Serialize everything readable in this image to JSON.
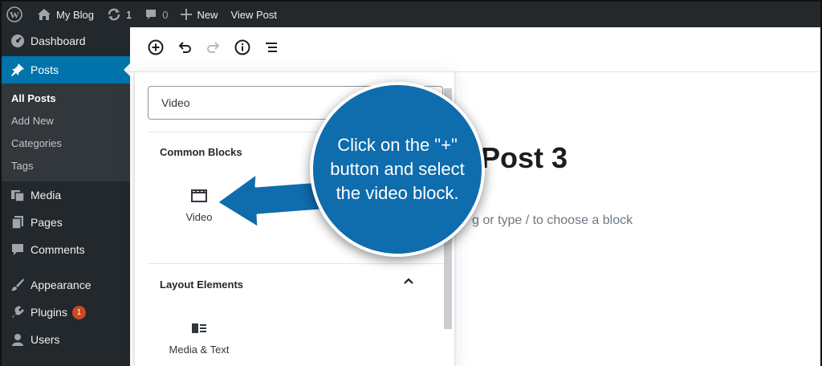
{
  "adminbar": {
    "site_name": "My Blog",
    "updates_count": "1",
    "comments_count": "0",
    "new_label": "New",
    "view_post_label": "View Post"
  },
  "sidebar": {
    "items": [
      {
        "label": "Dashboard",
        "icon": "dashboard-icon"
      },
      {
        "label": "Posts",
        "icon": "pin-icon"
      },
      {
        "label": "Media",
        "icon": "media-icon"
      },
      {
        "label": "Pages",
        "icon": "pages-icon"
      },
      {
        "label": "Comments",
        "icon": "comment-icon"
      },
      {
        "label": "Appearance",
        "icon": "paintbrush-icon"
      },
      {
        "label": "Plugins",
        "icon": "plugin-icon",
        "badge": "1"
      },
      {
        "label": "Users",
        "icon": "users-icon"
      }
    ],
    "posts_submenu": [
      "All Posts",
      "Add New",
      "Categories",
      "Tags"
    ]
  },
  "editor": {
    "title": "Post 3",
    "placeholder": "g or type / to choose a block"
  },
  "inserter": {
    "search_value": "Video",
    "section_common": "Common Blocks",
    "section_layout": "Layout Elements",
    "common_blocks": [
      {
        "label": "Video",
        "icon": "video-icon"
      }
    ],
    "layout_blocks": [
      {
        "label": "Media & Text",
        "icon": "media-text-icon"
      }
    ]
  },
  "callout": {
    "text": "Click on the \"+\" button and select the video block."
  },
  "colors": {
    "adminbar_bg": "#23282d",
    "accent": "#0073aa",
    "callout_bg": "#0f6cad",
    "badge": "#ca4a1f"
  }
}
